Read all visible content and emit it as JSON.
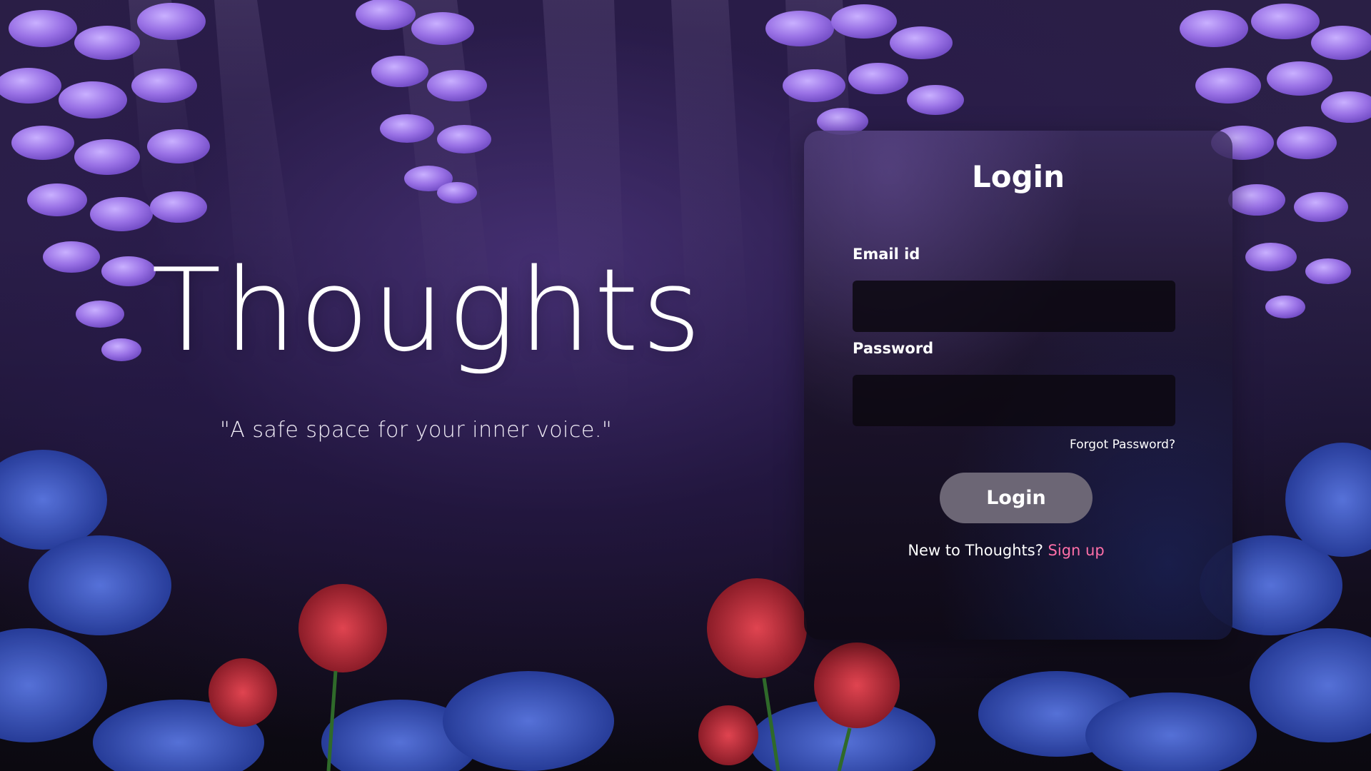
{
  "brand": {
    "title": "Thoughts",
    "tagline": "\"A safe space for your inner voice.\""
  },
  "login_card": {
    "title": "Login",
    "email_label": "Email id",
    "email_value": "",
    "password_label": "Password",
    "password_value": "",
    "forgot_password": "Forgot Password?",
    "login_button": "Login",
    "signup_prompt": "New to Thoughts?",
    "signup_link": "Sign up"
  },
  "colors": {
    "accent_link": "#ff6fa8",
    "button_bg": "#6c6675",
    "wisteria": "#9a72e6",
    "lily_blue": "#2f4fc0",
    "lily_red": "#b2222c"
  }
}
